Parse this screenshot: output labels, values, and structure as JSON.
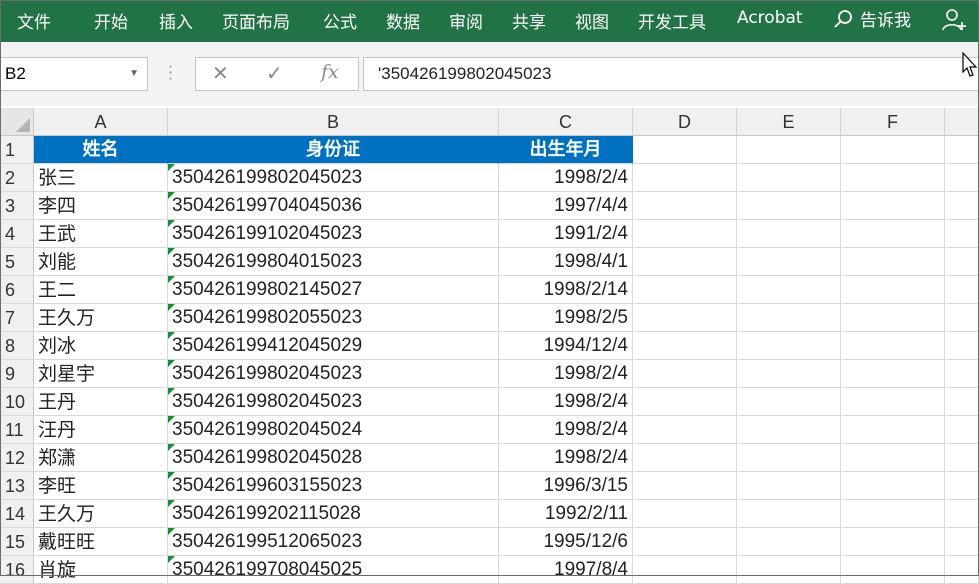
{
  "ribbon": {
    "tabs": [
      "文件",
      "开始",
      "插入",
      "页面布局",
      "公式",
      "数据",
      "审阅",
      "共享",
      "视图",
      "开发工具",
      "Acrobat"
    ],
    "tell_me": "告诉我"
  },
  "formula_bar": {
    "name_box": "B2",
    "content": "'350426199802045023"
  },
  "columns": [
    "A",
    "B",
    "C",
    "D",
    "E",
    "F"
  ],
  "header_row": {
    "row": "1",
    "a": "姓名",
    "b": "身份证",
    "c": "出生年月"
  },
  "rows": [
    {
      "row": "2",
      "name": "张三",
      "id": "350426199802045023",
      "date": "1998/2/4"
    },
    {
      "row": "3",
      "name": "李四",
      "id": "350426199704045036",
      "date": "1997/4/4"
    },
    {
      "row": "4",
      "name": "王武",
      "id": "350426199102045023",
      "date": "1991/2/4"
    },
    {
      "row": "5",
      "name": "刘能",
      "id": "350426199804015023",
      "date": "1998/4/1"
    },
    {
      "row": "6",
      "name": "王二",
      "id": "350426199802145027",
      "date": "1998/2/14"
    },
    {
      "row": "7",
      "name": "王久万",
      "id": "350426199802055023",
      "date": "1998/2/5"
    },
    {
      "row": "8",
      "name": "刘冰",
      "id": "350426199412045029",
      "date": "1994/12/4"
    },
    {
      "row": "9",
      "name": "刘星宇",
      "id": "350426199802045023",
      "date": "1998/2/4"
    },
    {
      "row": "10",
      "name": "王丹",
      "id": "350426199802045023",
      "date": "1998/2/4"
    },
    {
      "row": "11",
      "name": "汪丹",
      "id": "350426199802045024",
      "date": "1998/2/4"
    },
    {
      "row": "12",
      "name": "郑潇",
      "id": "350426199802045028",
      "date": "1998/2/4"
    },
    {
      "row": "13",
      "name": "李旺",
      "id": "350426199603155023",
      "date": "1996/3/15"
    },
    {
      "row": "14",
      "name": "王久万",
      "id": "350426199202115028",
      "date": "1992/2/11"
    },
    {
      "row": "15",
      "name": "戴旺旺",
      "id": "350426199512065023",
      "date": "1995/12/6"
    },
    {
      "row": "16",
      "name": "肖旋",
      "id": "350426199708045025",
      "date": "1997/8/4"
    }
  ],
  "colors": {
    "ribbon": "#217346",
    "header_fill": "#0070c0",
    "error_flag": "#1a8f3a"
  }
}
